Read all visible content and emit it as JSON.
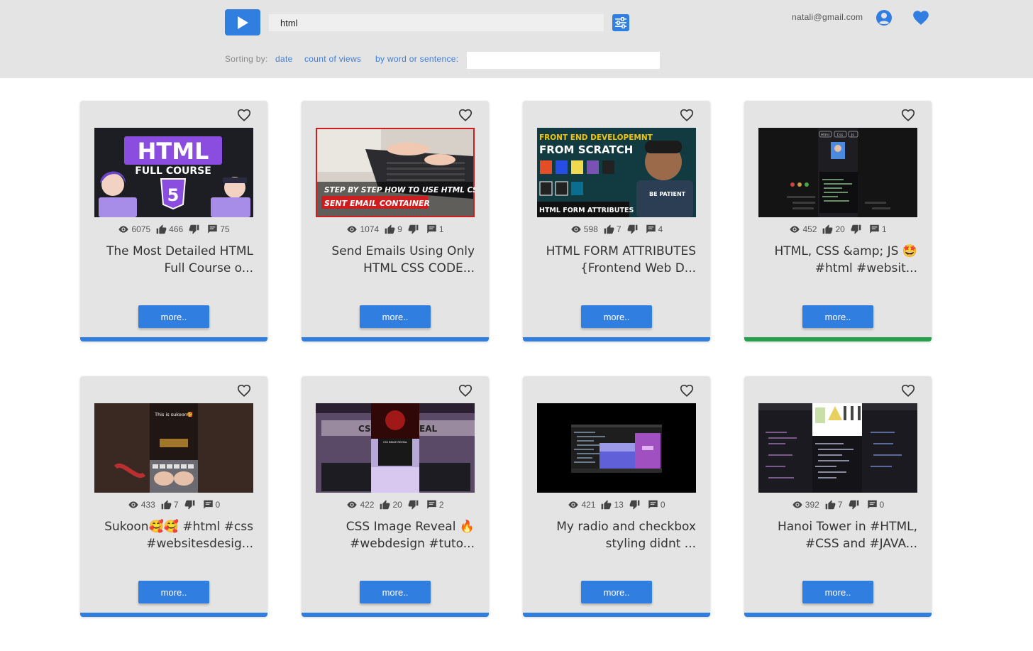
{
  "header": {
    "search_value": "html",
    "user_email": "natali@gmail.com",
    "logo_icon": "play-icon",
    "filter_icon": "sliders-icon",
    "user_icon": "account-circle-icon",
    "favorites_icon": "heart-icon",
    "sorting": {
      "label": "Sorting by:",
      "date": "date",
      "views": "count of views",
      "word": "by word or sentence:",
      "word_value": ""
    }
  },
  "colors": {
    "accent": "#2f7ee0",
    "header_bg": "#e4e4e4",
    "card_bg": "#e4e4e4",
    "bar_default": "#2f7ee0",
    "bar_highlight": "#25a04d"
  },
  "cards": [
    {
      "views": "6075",
      "likes": "466",
      "comments": "75",
      "title": "The Most Detailed HTML Full Course o...",
      "button": "more..",
      "bar_color": "#2f7ee0"
    },
    {
      "views": "1074",
      "likes": "9",
      "comments": "1",
      "title": "Send Emails Using Only HTML CSS CODE...",
      "button": "more..",
      "bar_color": "#2f7ee0"
    },
    {
      "views": "598",
      "likes": "7",
      "comments": "4",
      "title": "HTML FORM ATTRIBUTES {Frontend Web D...",
      "button": "more..",
      "bar_color": "#2f7ee0"
    },
    {
      "views": "452",
      "likes": "20",
      "comments": "1",
      "title": "HTML, CSS &amp; JS 🤩 #html #websit...",
      "button": "more..",
      "bar_color": "#25a04d"
    },
    {
      "views": "433",
      "likes": "7",
      "comments": "0",
      "title": "Sukoon🥰🥰 #html #css #websitesdesig...",
      "button": "more..",
      "bar_color": "#2f7ee0"
    },
    {
      "views": "422",
      "likes": "20",
      "comments": "2",
      "title": "CSS Image Reveal 🔥 #webdesign #tuto...",
      "button": "more..",
      "bar_color": "#2f7ee0"
    },
    {
      "views": "421",
      "likes": "13",
      "comments": "0",
      "title": "My radio and checkbox styling didnt ...",
      "button": "more..",
      "bar_color": "#2f7ee0"
    },
    {
      "views": "392",
      "likes": "7",
      "comments": "0",
      "title": "Hanoi Tower in #HTML, #CSS and #JAVA...",
      "button": "more..",
      "bar_color": "#2f7ee0"
    }
  ],
  "thumbnails": {
    "t1": {
      "line1": "HTML",
      "line2": "FULL COURSE",
      "badge": "5"
    },
    "t2": {
      "line1": "STEP BY STEP HOW TO USE HTML CSS",
      "line2": "SENT EMAIL CONTAINER"
    },
    "t3": {
      "line1": "FRONT END DEVELOPEMNT",
      "line2": "FROM SCRATCH",
      "line3": "HTML FORM ATTRIBUTES",
      "badge": "BE PATIENT"
    },
    "t4": {
      "tab1": "Html",
      "tab2": "Css",
      "tab3": "Js"
    },
    "t5": {
      "caption": "This is sukoon🥰"
    },
    "t6": {
      "left": "CSS",
      "right": "EAL",
      "inner": "CSS IMAGE REVEAL"
    }
  }
}
